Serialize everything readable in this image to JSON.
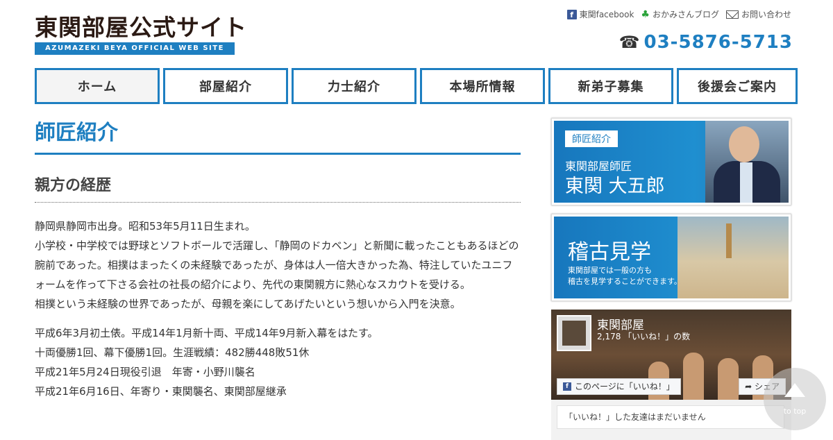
{
  "header": {
    "logo_title": "東関部屋公式サイト",
    "logo_subtitle": "AZUMAZEKI BEYA OFFICIAL WEB SITE",
    "links": {
      "facebook": "東関facebook",
      "blog": "おかみさんブログ",
      "contact": "お問い合わせ"
    },
    "phone": "03-5876-5713"
  },
  "nav": {
    "items": [
      "ホーム",
      "部屋紹介",
      "力士紹介",
      "本場所情報",
      "新弟子募集",
      "後援会ご案内"
    ]
  },
  "main": {
    "page_title": "師匠紹介",
    "section_title": "親方の経歴",
    "para1": [
      "静岡県静岡市出身。昭和53年5月11日生まれ。",
      "小学校・中学校では野球とソフトボールで活躍し、「静岡のドカベン」と新聞に載ったこともあるほどの腕前であった。相撲はまったくの未経験であったが、身体は人一倍大きかった為、特注していたユニフォームを作って下さる会社の社長の紹介により、先代の東関親方に熱心なスカウトを受ける。",
      "相撲という未経験の世界であったが、母親を楽にしてあげたいという想いから入門を決意。"
    ],
    "para2": [
      "平成6年3月初土俵。平成14年1月新十両、平成14年9月新入幕をはたす。",
      "十両優勝1回、幕下優勝1回。生涯戦績：482勝448敗51休",
      "平成21年5月24日現役引退　年寄・小野川襲名",
      "平成21年6月16日、年寄り・東関襲名、東関部屋継承"
    ]
  },
  "sidebar": {
    "banner1": {
      "tag": "師匠紹介",
      "line1": "東関部屋師匠",
      "line2": "東関 大五郎"
    },
    "banner2": {
      "title": "稽古見学",
      "sub1": "東関部屋では一般の方も",
      "sub2": "稽古を見学することができます。"
    },
    "facebook": {
      "page_name": "東関部屋",
      "likes": "2,178 「いいね！」の数",
      "like_button": "このページに「いいね！」",
      "share_button": "シェア",
      "friends": "「いいね！」した友達はまだいません"
    }
  },
  "to_top": {
    "label": "to top"
  },
  "colors": {
    "accent": "#1e7fc1"
  }
}
